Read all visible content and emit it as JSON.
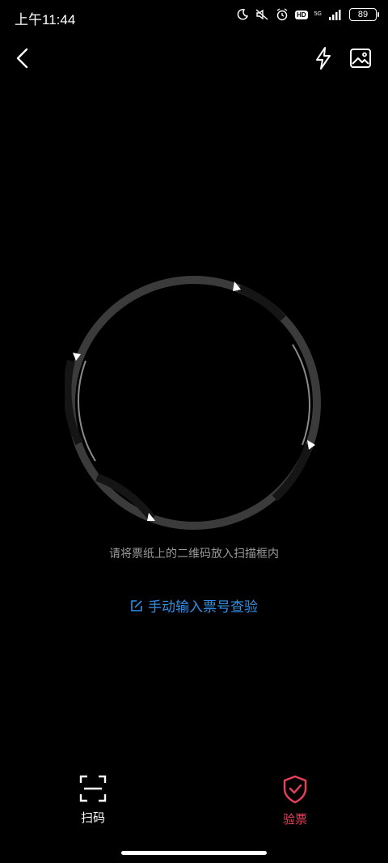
{
  "status": {
    "time": "上午11:44",
    "hd": "HD",
    "network": "5G",
    "battery": "89"
  },
  "topbar": {
    "back_icon": "chevron-left-icon",
    "flash_icon": "flash-icon",
    "gallery_icon": "image-icon"
  },
  "scanner": {
    "hint": "请将票纸上的二维码放入扫描框内",
    "manual_entry": "手动输入票号查验"
  },
  "tabs": {
    "scan": {
      "label": "扫码",
      "icon": "scan-frame-icon"
    },
    "verify": {
      "label": "验票",
      "icon": "shield-check-icon",
      "active_color": "#e8405b"
    }
  },
  "colors": {
    "accent": "#2f8fe8",
    "active_tab": "#e8405b",
    "background": "#000000"
  }
}
